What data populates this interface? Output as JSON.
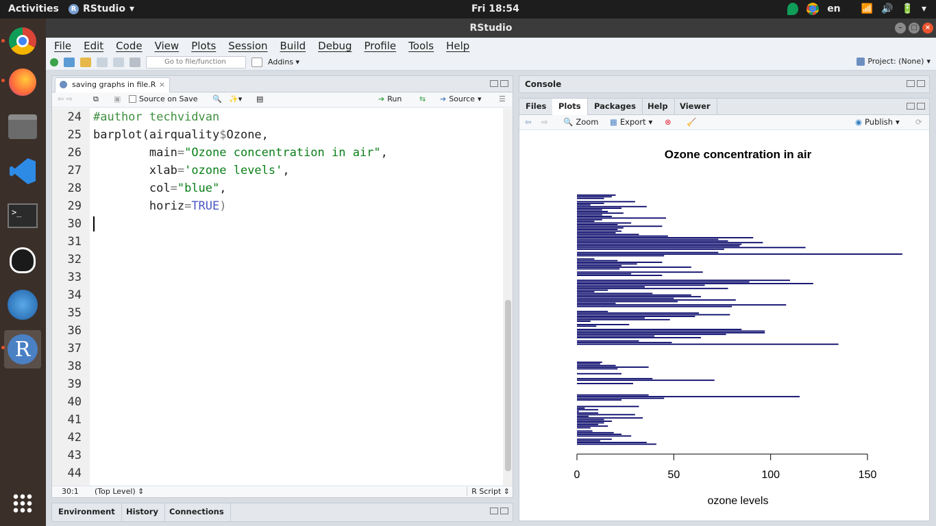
{
  "topbar": {
    "activities": "Activities",
    "app_name": "RStudio",
    "app_badge": "R",
    "clock": "Fri 18:54",
    "lang": "en"
  },
  "dock": [
    "chrome-icon",
    "firefox-icon",
    "files-icon",
    "vscode-icon",
    "terminal-icon",
    "inkscape-icon",
    "openoffice-icon",
    "rstudio-icon",
    "apps-grid-icon"
  ],
  "window": {
    "title": "RStudio"
  },
  "menu": [
    "File",
    "Edit",
    "Code",
    "View",
    "Plots",
    "Session",
    "Build",
    "Debug",
    "Profile",
    "Tools",
    "Help"
  ],
  "toolbar": {
    "goto_placeholder": "Go to file/function",
    "addins": "Addins",
    "project": "Project: (None)"
  },
  "editor": {
    "tab_label": "saving graphs in file.R",
    "source_on_save": "Source on Save",
    "run": "Run",
    "source": "Source",
    "line_numbers": [
      "24",
      "25",
      "26",
      "27",
      "28",
      "29",
      "30",
      "31",
      "32",
      "33",
      "34",
      "35",
      "36",
      "37",
      "38",
      "39",
      "40",
      "41",
      "42",
      "43",
      "44"
    ],
    "code": {
      "l24": "#author techvidvan",
      "l25a": "barplot(airquality",
      "l25b": "$",
      "l25c": "Ozone,",
      "l26a": "        main",
      "l26b": "=",
      "l26c": "\"Ozone concentration in air\"",
      "l26d": ",",
      "l27a": "        xlab",
      "l27b": "=",
      "l27c": "'ozone levels'",
      "l27d": ",",
      "l28a": "        col",
      "l28b": "=",
      "l28c": "\"blue\"",
      "l28d": ",",
      "l29a": "        horiz",
      "l29b": "=",
      "l29c": "TRUE",
      "l29d": ")"
    },
    "status": {
      "position": "30:1",
      "scope": "(Top Level)",
      "type": "R Script"
    }
  },
  "env_tabs": [
    "Environment",
    "History",
    "Connections"
  ],
  "console_title": "Console",
  "plots_tabs": [
    "Files",
    "Plots",
    "Packages",
    "Help",
    "Viewer"
  ],
  "plots_toolbar": {
    "zoom": "Zoom",
    "export": "Export",
    "publish": "Publish"
  },
  "colors": {
    "bar": "#000066",
    "accent": "#e9542f",
    "rstudio_blue": "#4a6fa5"
  },
  "chart_data": {
    "type": "bar",
    "orientation": "horizontal",
    "title": "Ozone concentration in air",
    "xlabel": "ozone levels",
    "xlim": [
      0,
      153
    ],
    "xticks": [
      "0",
      "50",
      "100",
      "150"
    ],
    "bar_color": "blue",
    "values": [
      41,
      36,
      12,
      18,
      null,
      28,
      23,
      19,
      8,
      null,
      7,
      16,
      11,
      14,
      18,
      14,
      34,
      6,
      30,
      11,
      1,
      11,
      4,
      32,
      null,
      null,
      null,
      23,
      45,
      115,
      37,
      null,
      null,
      null,
      null,
      null,
      null,
      29,
      null,
      71,
      39,
      null,
      null,
      23,
      null,
      null,
      21,
      37,
      20,
      12,
      13,
      null,
      null,
      null,
      null,
      null,
      null,
      null,
      null,
      null,
      null,
      135,
      49,
      32,
      null,
      64,
      40,
      77,
      97,
      97,
      85,
      null,
      10,
      27,
      null,
      7,
      48,
      35,
      61,
      79,
      63,
      16,
      null,
      null,
      80,
      108,
      20,
      52,
      82,
      50,
      64,
      59,
      39,
      9,
      16,
      78,
      35,
      66,
      122,
      89,
      110,
      null,
      null,
      44,
      28,
      65,
      null,
      22,
      59,
      23,
      31,
      44,
      21,
      9,
      null,
      45,
      168,
      73,
      null,
      76,
      118,
      84,
      85,
      96,
      78,
      73,
      91,
      47,
      32,
      20,
      23,
      21,
      24,
      44,
      21,
      28,
      9,
      13,
      46,
      18,
      13,
      24,
      16,
      13,
      23,
      36,
      7,
      14,
      30,
      null,
      14,
      18,
      20
    ]
  }
}
